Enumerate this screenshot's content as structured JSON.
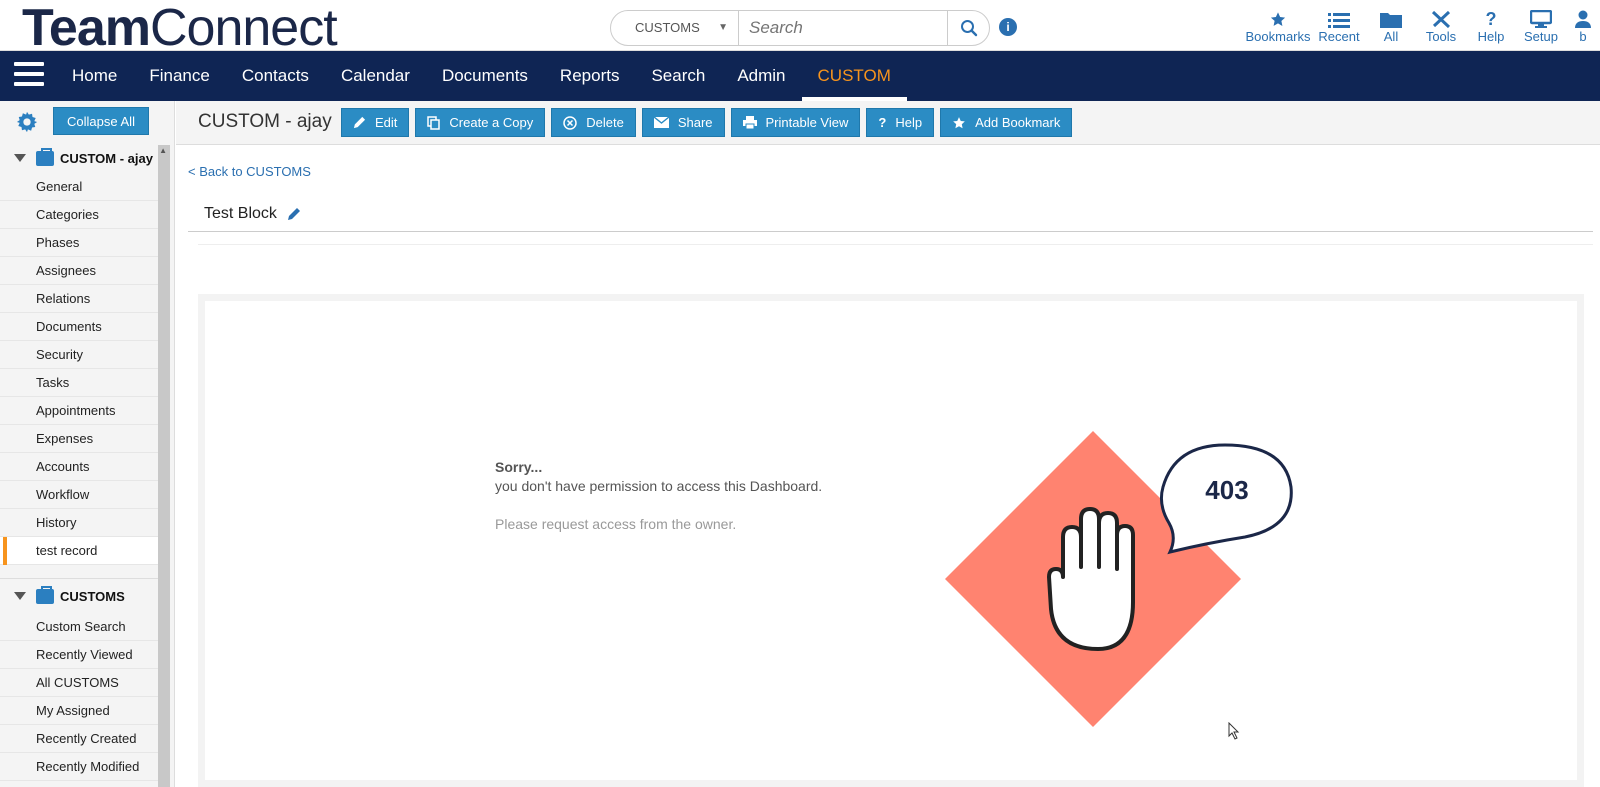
{
  "header": {
    "logo_bold": "Team",
    "logo_light": "Connect",
    "search_scope": "CUSTOMS",
    "search_placeholder": "Search",
    "tools": [
      {
        "label": "Bookmarks",
        "icon": "star-icon"
      },
      {
        "label": "Recent",
        "icon": "list-icon"
      },
      {
        "label": "All",
        "icon": "folder-icon"
      },
      {
        "label": "Tools",
        "icon": "wrench-icon"
      },
      {
        "label": "Help",
        "icon": "question-icon"
      },
      {
        "label": "Setup",
        "icon": "monitor-icon"
      },
      {
        "label": "b",
        "icon": "user-icon"
      }
    ]
  },
  "nav": {
    "items": [
      "Home",
      "Finance",
      "Contacts",
      "Calendar",
      "Documents",
      "Reports",
      "Search",
      "Admin",
      "CUSTOM"
    ],
    "active": "CUSTOM"
  },
  "sidebar": {
    "collapse_label": "Collapse All",
    "section1": {
      "title": "CUSTOM - ajay",
      "items": [
        "General",
        "Categories",
        "Phases",
        "Assignees",
        "Relations",
        "Documents",
        "Security",
        "Tasks",
        "Appointments",
        "Expenses",
        "Accounts",
        "Workflow",
        "History",
        "test record"
      ],
      "selected": "test record"
    },
    "section2": {
      "title": "CUSTOMS",
      "items": [
        "Custom Search",
        "Recently Viewed",
        "All CUSTOMS",
        "My Assigned",
        "Recently Created",
        "Recently Modified"
      ]
    }
  },
  "toolbar": {
    "record_title": "CUSTOM - ajay",
    "buttons": [
      {
        "label": "Edit",
        "icon": "pencil-icon"
      },
      {
        "label": "Create a Copy",
        "icon": "copy-icon"
      },
      {
        "label": "Delete",
        "icon": "delete-icon"
      },
      {
        "label": "Share",
        "icon": "envelope-icon"
      },
      {
        "label": "Printable View",
        "icon": "printer-icon"
      },
      {
        "label": "Help",
        "icon": "question-icon"
      },
      {
        "label": "Add Bookmark",
        "icon": "star-icon"
      }
    ]
  },
  "main": {
    "back_link": "< Back to CUSTOMS",
    "block_title": "Test Block",
    "error": {
      "sorry": "Sorry...",
      "message": "you don't have permission to access this Dashboard.",
      "hint": "Please request access from the owner.",
      "code": "403"
    }
  },
  "colors": {
    "navbar": "#0f2554",
    "accent": "#f7941d",
    "button": "#2b8cc4",
    "diamond": "#ff8370"
  }
}
